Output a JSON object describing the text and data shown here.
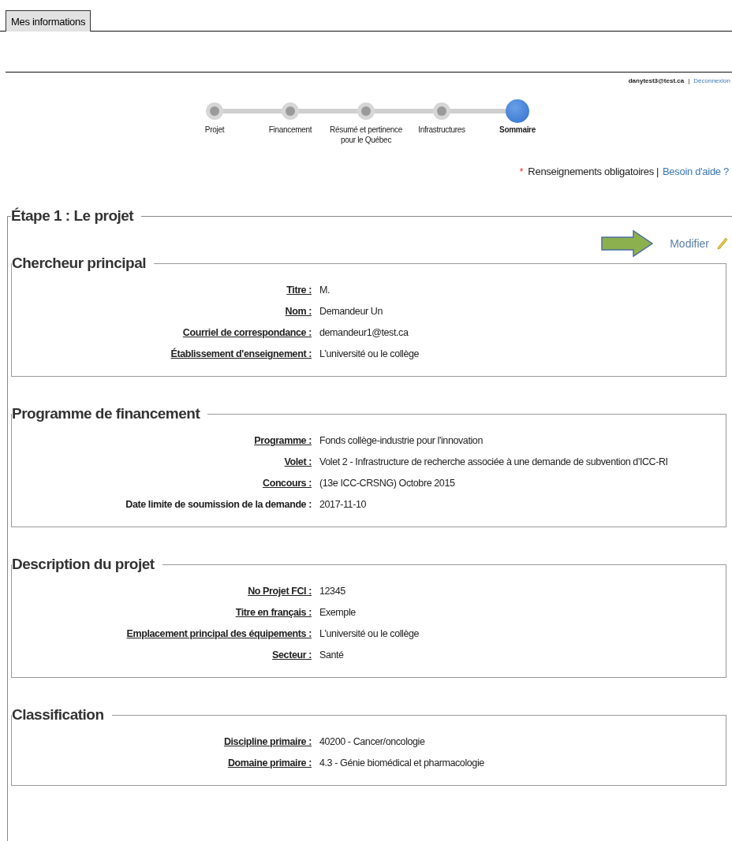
{
  "tab": {
    "label": "Mes informations"
  },
  "user_bar": {
    "email": "danytest3@test.ca",
    "separator": "|",
    "logout": "Déconnexion"
  },
  "steps": [
    {
      "label": "Projet",
      "selected": false
    },
    {
      "label": "Financement",
      "selected": false
    },
    {
      "label": "Résumé et pertinence pour le Québec",
      "selected": false
    },
    {
      "label": "Infrastructures",
      "selected": false
    },
    {
      "label": "Sommaire",
      "selected": true
    }
  ],
  "help_bar": {
    "asterisk": "*",
    "required": "Renseignements obligatoires",
    "separator": "|",
    "help": "Besoin d'aide ?"
  },
  "stage": {
    "title": "Étape 1 : Le projet",
    "edit_link": "Modifier",
    "sections": [
      {
        "title": "Chercheur principal",
        "fields": [
          {
            "label": "Titre :",
            "value": "M.",
            "underlined": true
          },
          {
            "label": "Nom :",
            "value": "Demandeur Un",
            "underlined": true
          },
          {
            "label": "Courriel de correspondance :",
            "value": "demandeur1@test.ca",
            "underlined": true
          },
          {
            "label": "Établissement d'enseignement :",
            "value": "L'université ou le collège",
            "underlined": true
          }
        ]
      },
      {
        "title": "Programme de financement",
        "fields": [
          {
            "label": "Programme :",
            "value": "Fonds collège-industrie pour l'innovation",
            "underlined": true
          },
          {
            "label": "Volet :",
            "value": "Volet 2 - Infrastructure de recherche associée à une demande de subvention d'ICC-RI",
            "underlined": true
          },
          {
            "label": "Concours :",
            "value": "(13e ICC-CRSNG) Octobre 2015",
            "underlined": true
          },
          {
            "label": "Date limite de soumission de la demande :",
            "value": "2017-11-10",
            "underlined": false
          }
        ]
      },
      {
        "title": "Description du projet",
        "fields": [
          {
            "label": "No Projet FCI :",
            "value": "12345",
            "underlined": true
          },
          {
            "label": "Titre en français :",
            "value": "Exemple",
            "underlined": true
          },
          {
            "label": "Emplacement principal des équipements :",
            "value": "L'université ou le collège",
            "underlined": true
          },
          {
            "label": "Secteur :",
            "value": "Santé",
            "underlined": true
          }
        ]
      },
      {
        "title": "Classification",
        "fields": [
          {
            "label": "Discipline primaire :",
            "value": "40200 - Cancer/oncologie",
            "underlined": true
          },
          {
            "label": "Domaine primaire :",
            "value": "4.3 - Génie biomédical et pharmacologie",
            "underlined": true
          }
        ]
      }
    ]
  }
}
